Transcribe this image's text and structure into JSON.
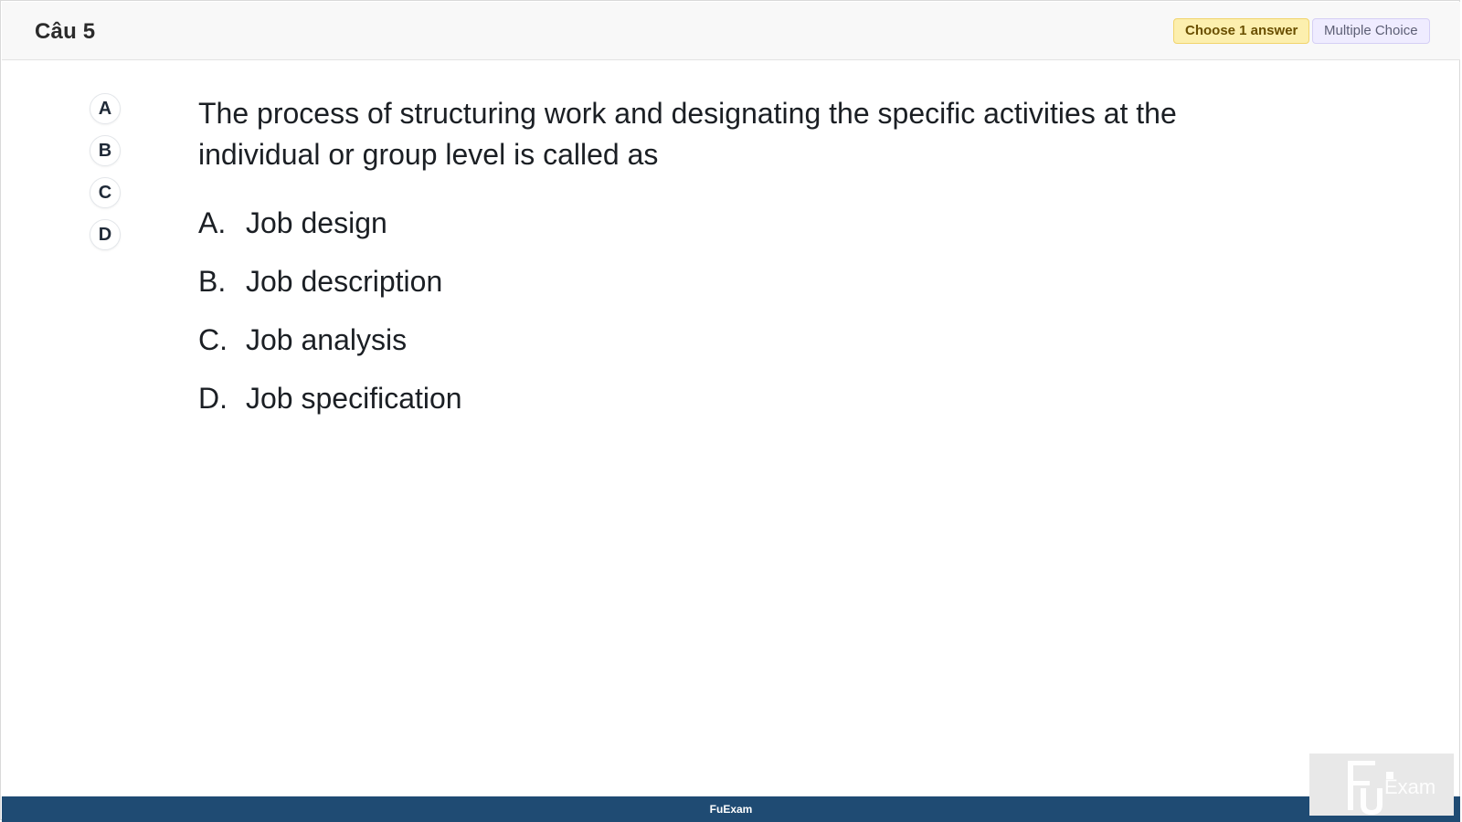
{
  "header": {
    "title": "Câu 5",
    "choose_badge": "Choose 1 answer",
    "type_badge": "Multiple Choice"
  },
  "answer_buttons": [
    "A",
    "B",
    "C",
    "D"
  ],
  "question": {
    "text": "The process of structuring work and designating the specific activities at the individual or group level is called as",
    "options": [
      {
        "letter": "A.",
        "text": "Job design"
      },
      {
        "letter": "B.",
        "text": "Job description"
      },
      {
        "letter": "C.",
        "text": "Job analysis"
      },
      {
        "letter": "D.",
        "text": "Job specification"
      }
    ]
  },
  "footer": {
    "brand": "FuExam"
  },
  "watermark": {
    "text": "FU Exam"
  },
  "colors": {
    "footer_bg": "#1f4b73",
    "choose_badge_bg": "#fcefae",
    "type_badge_bg": "#efecff"
  }
}
